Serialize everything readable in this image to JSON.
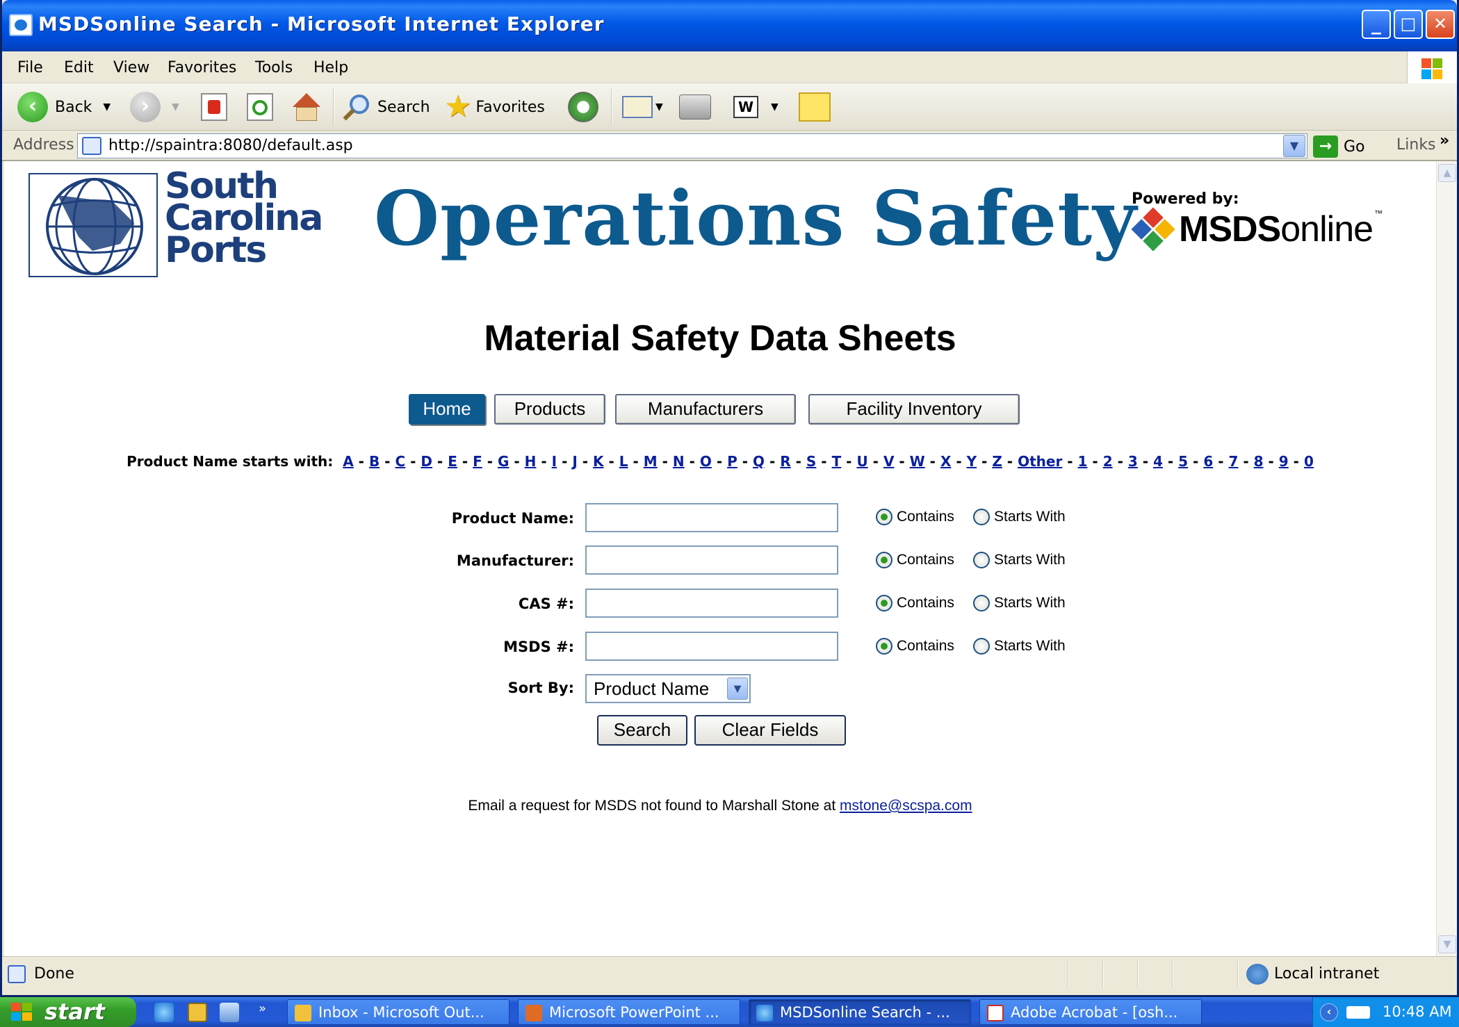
{
  "window": {
    "title": "MSDSonline Search - Microsoft Internet Explorer",
    "controls": {
      "minimize": "_",
      "maximize": "□",
      "close": "✕"
    }
  },
  "menubar": [
    "File",
    "Edit",
    "View",
    "Favorites",
    "Tools",
    "Help"
  ],
  "toolbar": {
    "back_label": "Back",
    "search_label": "Search",
    "favorites_label": "Favorites",
    "icons": [
      "back-icon",
      "forward-icon",
      "stop-icon",
      "refresh-icon",
      "home-icon",
      "search-icon",
      "favorites-star-icon",
      "history-icon",
      "mail-icon",
      "print-icon",
      "edit-word-icon",
      "discuss-note-icon"
    ]
  },
  "addressbar": {
    "label": "Address",
    "url": "http://spaintra:8080/default.asp",
    "go_label": "Go",
    "links_label": "Links"
  },
  "page": {
    "logo_text": [
      "South",
      "Carolina",
      "Ports"
    ],
    "banner_title": "Operations Safety",
    "powered_by": "Powered by:",
    "msds_logo": {
      "bold": "MSDS",
      "regular": "online",
      "tm": "™"
    },
    "heading": "Material Safety Data Sheets",
    "nav": {
      "home": "Home",
      "products": "Products",
      "manufacturers": "Manufacturers",
      "facility_inventory": "Facility Inventory"
    },
    "alpha_label": "Product Name starts with:",
    "alpha_links": [
      "A",
      "B",
      "C",
      "D",
      "E",
      "F",
      "G",
      "H",
      "I",
      "J",
      "K",
      "L",
      "M",
      "N",
      "O",
      "P",
      "Q",
      "R",
      "S",
      "T",
      "U",
      "V",
      "W",
      "X",
      "Y",
      "Z",
      "Other",
      "1",
      "2",
      "3",
      "4",
      "5",
      "6",
      "7",
      "8",
      "9",
      "0"
    ],
    "fields": [
      {
        "label": "Product Name:",
        "value": "",
        "contains": "Contains",
        "starts_with": "Starts With",
        "selected": "contains"
      },
      {
        "label": "Manufacturer:",
        "value": "",
        "contains": "Contains",
        "starts_with": "Starts With",
        "selected": "contains"
      },
      {
        "label": "CAS #:",
        "value": "",
        "contains": "Contains",
        "starts_with": "Starts With",
        "selected": "contains"
      },
      {
        "label": "MSDS #:",
        "value": "",
        "contains": "Contains",
        "starts_with": "Starts With",
        "selected": "contains"
      }
    ],
    "sort_label": "Sort By:",
    "sort_value": "Product Name",
    "search_button": "Search",
    "clear_button": "Clear Fields",
    "email_text": "Email a request for MSDS not found to Marshall Stone at ",
    "email_link": "mstone@scspa.com"
  },
  "statusbar": {
    "status": "Done",
    "zone": "Local intranet"
  },
  "taskbar": {
    "start_label": "start",
    "tasks": [
      {
        "label": "Inbox - Microsoft Out...",
        "icon": "outlook-icon",
        "active": false
      },
      {
        "label": "Microsoft PowerPoint ...",
        "icon": "powerpoint-icon",
        "active": false
      },
      {
        "label": "MSDSonline Search - ...",
        "icon": "ie-icon",
        "active": true
      },
      {
        "label": "Adobe Acrobat - [osh...",
        "icon": "acrobat-icon",
        "active": false
      }
    ],
    "clock": "10:48 AM"
  },
  "colors": {
    "brand_blue": "#0d5a8f",
    "link_blue": "#0a1f9c",
    "xp_title": "#0058e6"
  }
}
